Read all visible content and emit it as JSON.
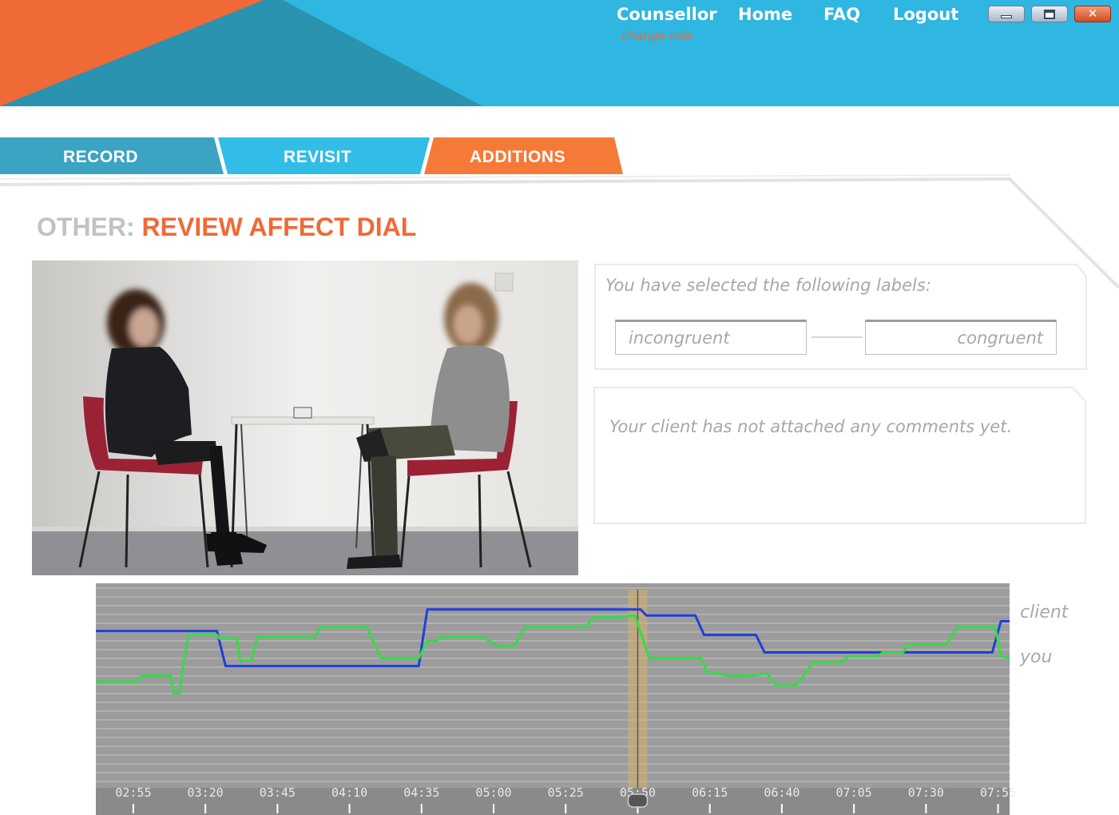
{
  "header": {
    "role": "Counsellor",
    "change_role": "change role",
    "nav": {
      "home": "Home",
      "faq": "FAQ",
      "logout": "Logout"
    },
    "window_controls": {
      "minimize": "minimize-icon",
      "maximize": "maximize-icon",
      "close": "close-icon"
    },
    "colors": {
      "banner": "#2fb6e1",
      "accent": "#ef6a37",
      "triangle": "#2a93b0"
    }
  },
  "tabs": [
    {
      "label": "RECORD",
      "color": "#3ba4c2"
    },
    {
      "label": "REVISIT",
      "color": "#31bde6"
    },
    {
      "label": "ADDITIONS",
      "color": "#f57a38"
    }
  ],
  "page": {
    "title_prefix": "OTHER:",
    "title_main": "REVIEW AFFECT DIAL"
  },
  "video": {
    "description_icon": "video-frame"
  },
  "labels_panel": {
    "heading": "You have selected the following labels:",
    "left_label": "incongruent",
    "right_label": "congruent"
  },
  "comments_panel": {
    "message": "Your client has not attached any comments yet."
  },
  "chart_data": {
    "type": "line",
    "x_ticks": [
      "02:55",
      "03:20",
      "03:45",
      "04:10",
      "04:35",
      "05:00",
      "05:25",
      "05:50",
      "06:15",
      "06:40",
      "07:05",
      "07:30",
      "07:55"
    ],
    "xlim": [
      "02:42",
      "07:59"
    ],
    "ylim": [
      0,
      1
    ],
    "cursor_time": "05:50",
    "series": [
      {
        "name": "client",
        "color": "#1f3fdb",
        "points": [
          [
            "02:42",
            0.78
          ],
          [
            "03:24",
            0.78
          ],
          [
            "03:27",
            0.6
          ],
          [
            "04:34",
            0.6
          ],
          [
            "04:37",
            0.89
          ],
          [
            "05:51",
            0.89
          ],
          [
            "05:53",
            0.86
          ],
          [
            "06:10",
            0.86
          ],
          [
            "06:13",
            0.76
          ],
          [
            "06:31",
            0.76
          ],
          [
            "06:34",
            0.67
          ],
          [
            "07:53",
            0.67
          ],
          [
            "07:56",
            0.83
          ],
          [
            "07:59",
            0.83
          ]
        ]
      },
      {
        "name": "you",
        "color": "#33dd44",
        "points": [
          [
            "02:42",
            0.52
          ],
          [
            "02:56",
            0.52
          ],
          [
            "02:58",
            0.55
          ],
          [
            "03:08",
            0.55
          ],
          [
            "03:09",
            0.46
          ],
          [
            "03:11",
            0.46
          ],
          [
            "03:14",
            0.76
          ],
          [
            "03:24",
            0.76
          ],
          [
            "03:25",
            0.74
          ],
          [
            "03:31",
            0.74
          ],
          [
            "03:32",
            0.63
          ],
          [
            "03:36",
            0.63
          ],
          [
            "03:38",
            0.75
          ],
          [
            "03:58",
            0.75
          ],
          [
            "04:00",
            0.8
          ],
          [
            "04:16",
            0.8
          ],
          [
            "04:21",
            0.64
          ],
          [
            "04:34",
            0.64
          ],
          [
            "04:37",
            0.73
          ],
          [
            "04:40",
            0.73
          ],
          [
            "04:42",
            0.75
          ],
          [
            "04:56",
            0.75
          ],
          [
            "05:02",
            0.7
          ],
          [
            "05:07",
            0.7
          ],
          [
            "05:11",
            0.8
          ],
          [
            "05:32",
            0.8
          ],
          [
            "05:35",
            0.85
          ],
          [
            "05:42",
            0.85
          ],
          [
            "05:49",
            0.86
          ],
          [
            "05:54",
            0.64
          ],
          [
            "06:12",
            0.64
          ],
          [
            "06:14",
            0.57
          ],
          [
            "06:22",
            0.55
          ],
          [
            "06:29",
            0.55
          ],
          [
            "06:35",
            0.56
          ],
          [
            "06:38",
            0.5
          ],
          [
            "06:45",
            0.5
          ],
          [
            "06:49",
            0.58
          ],
          [
            "06:51",
            0.62
          ],
          [
            "07:01",
            0.62
          ],
          [
            "07:03",
            0.65
          ],
          [
            "07:13",
            0.65
          ],
          [
            "07:15",
            0.67
          ],
          [
            "07:22",
            0.67
          ],
          [
            "07:24",
            0.71
          ],
          [
            "07:37",
            0.71
          ],
          [
            "07:41",
            0.8
          ],
          [
            "07:54",
            0.8
          ],
          [
            "07:56",
            0.65
          ],
          [
            "07:59",
            0.64
          ]
        ]
      }
    ],
    "grid": true,
    "legend": "right"
  }
}
